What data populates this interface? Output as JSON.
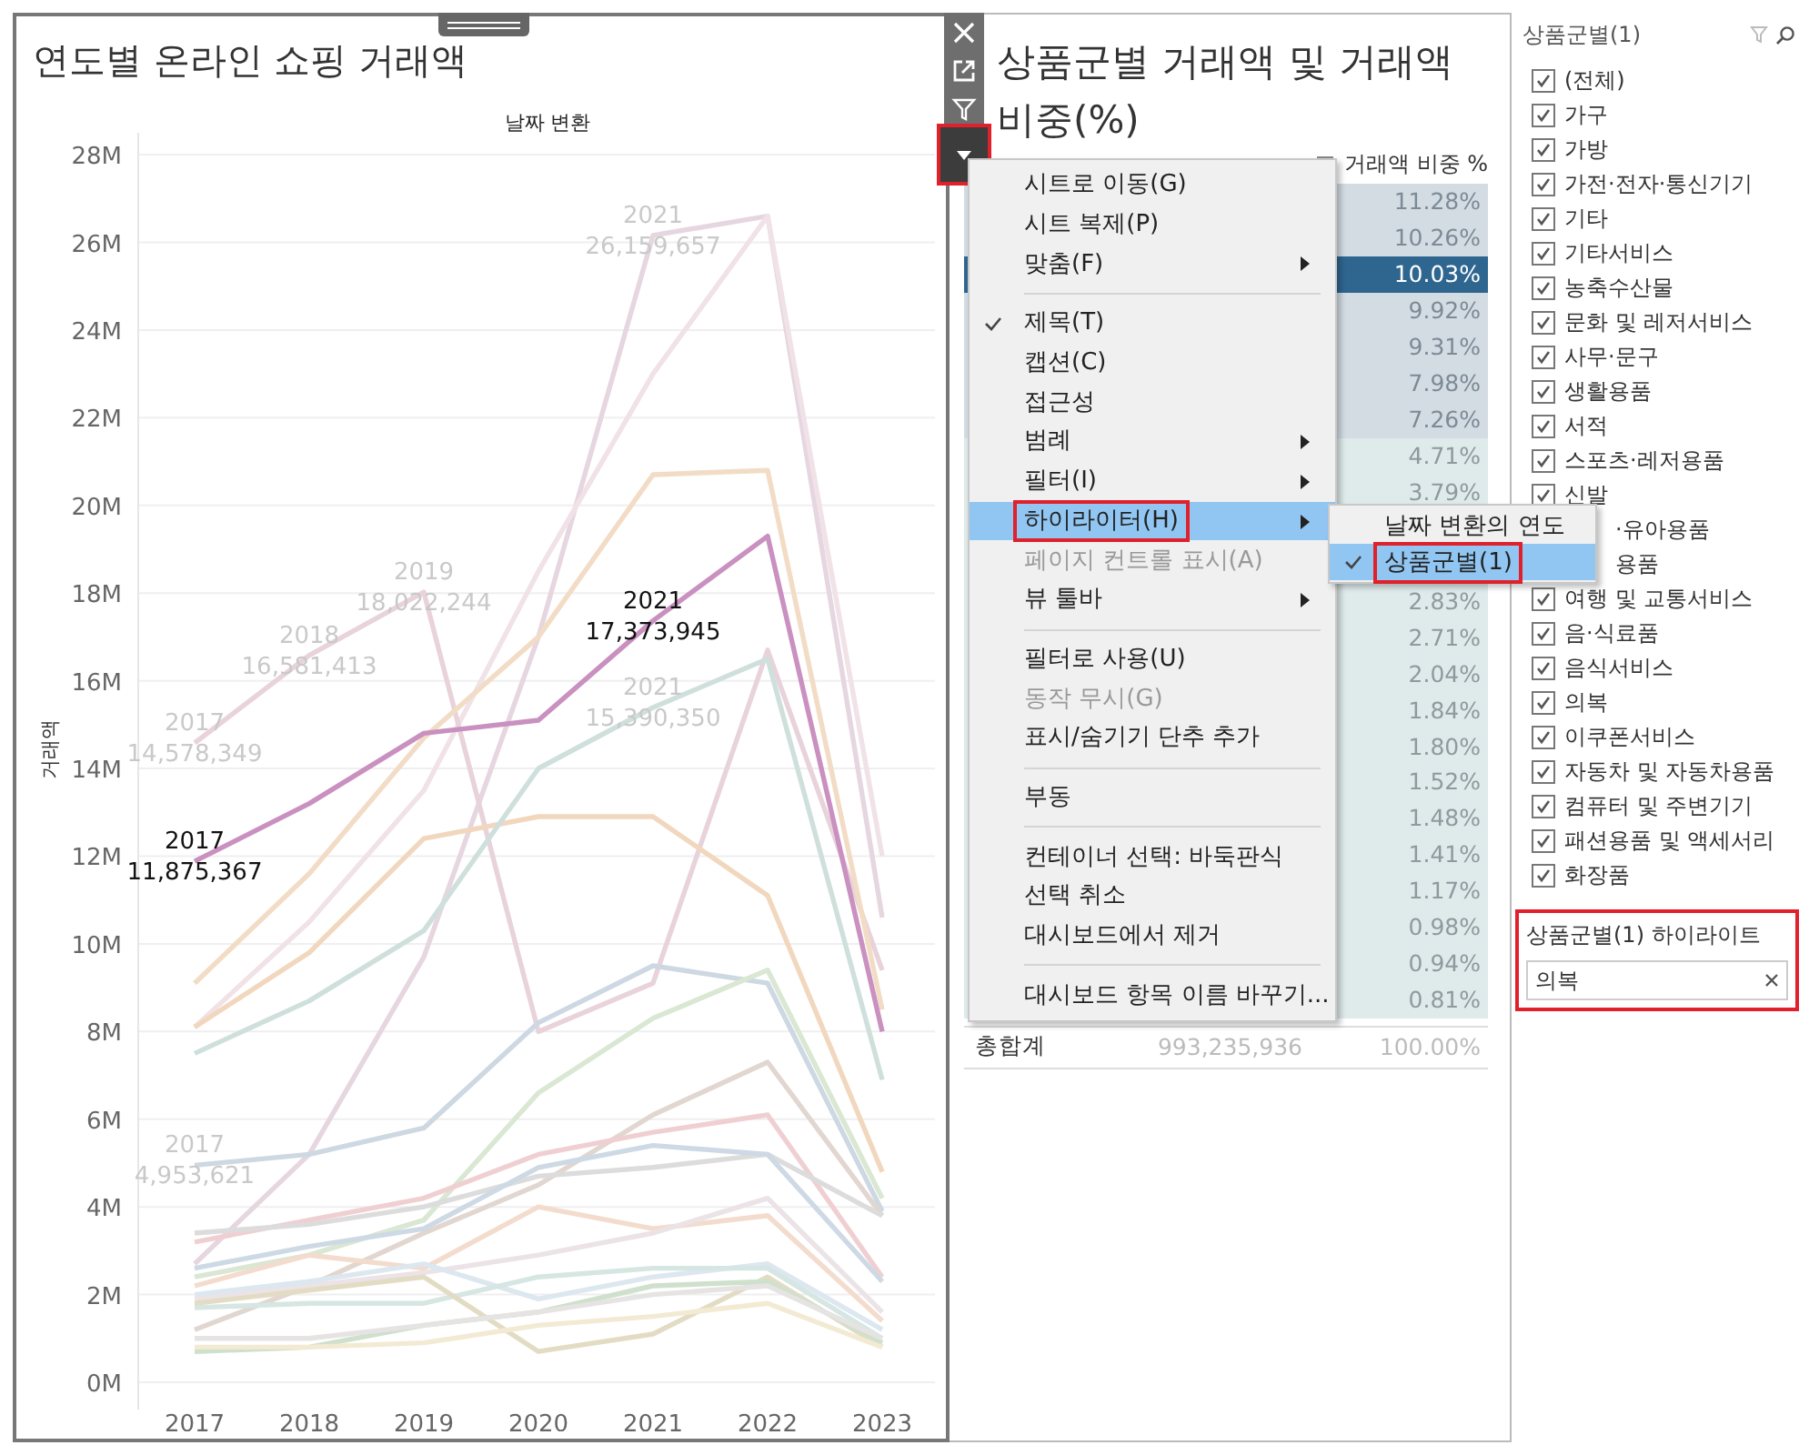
{
  "chart_panel": {
    "title": "연도별 온라인 쇼핑 거래액",
    "chart_data": {
      "type": "line",
      "title": "날짜 변환",
      "ylabel": "거래액",
      "grid": true,
      "x": [
        "2017",
        "2018",
        "2019",
        "2020",
        "2021",
        "2022",
        "2023"
      ],
      "ylim": [
        0,
        28.5
      ],
      "yticks": [
        {
          "value": 0,
          "label": "0M"
        },
        {
          "value": 2,
          "label": "2M"
        },
        {
          "value": 4,
          "label": "4M"
        },
        {
          "value": 6,
          "label": "6M"
        },
        {
          "value": 8,
          "label": "8M"
        },
        {
          "value": 10,
          "label": "10M"
        },
        {
          "value": 12,
          "label": "12M"
        },
        {
          "value": 14,
          "label": "14M"
        },
        {
          "value": 16,
          "label": "16M"
        },
        {
          "value": 18,
          "label": "18M"
        },
        {
          "value": 20,
          "label": "20M"
        },
        {
          "value": 22,
          "label": "22M"
        },
        {
          "value": 24,
          "label": "24M"
        },
        {
          "value": 26,
          "label": "26M"
        },
        {
          "value": 28,
          "label": "28M"
        }
      ],
      "series": [
        {
          "color": "#e6d6df",
          "values": [
            2.7,
            5.2,
            9.7,
            17.0,
            26.16,
            26.6,
            10.6
          ]
        },
        {
          "color": "#f0e2e7",
          "values": [
            8.1,
            10.5,
            13.5,
            18.5,
            23.0,
            26.6,
            12.0
          ]
        },
        {
          "color": "#e8d3da",
          "values": [
            14.58,
            16.58,
            18.02,
            8.0,
            9.1,
            16.7,
            9.4
          ]
        },
        {
          "color": "#f2dcc5",
          "values": [
            9.1,
            11.6,
            14.7,
            17.0,
            20.7,
            20.8,
            8.5
          ]
        },
        {
          "color": "#f1d7bd",
          "values": [
            8.1,
            9.8,
            12.4,
            12.9,
            12.9,
            11.1,
            4.8
          ]
        },
        {
          "color": "#cfe0dc",
          "values": [
            7.5,
            8.7,
            10.3,
            14.0,
            15.39,
            16.5,
            6.9
          ]
        },
        {
          "color": "#cdd8e2",
          "values": [
            4.95,
            5.2,
            5.8,
            8.2,
            9.5,
            9.1,
            3.9
          ]
        },
        {
          "color": "#d9e7d3",
          "values": [
            2.4,
            2.9,
            3.7,
            6.6,
            8.3,
            9.4,
            4.2
          ]
        },
        {
          "color": "#e1d6d0",
          "values": [
            1.2,
            2.2,
            3.4,
            4.5,
            6.1,
            7.3,
            3.8
          ]
        },
        {
          "color": "#f0cfd2",
          "values": [
            3.2,
            3.7,
            4.2,
            5.2,
            5.7,
            6.1,
            2.4
          ]
        },
        {
          "color": "#dcdcdc",
          "values": [
            3.4,
            3.6,
            4.0,
            4.7,
            4.9,
            5.2,
            3.8
          ]
        },
        {
          "color": "#cdd9e4",
          "values": [
            2.6,
            3.1,
            3.5,
            4.9,
            5.4,
            5.2,
            2.3
          ]
        },
        {
          "color": "#f3dccd",
          "values": [
            2.2,
            2.9,
            2.6,
            4.0,
            3.5,
            3.8,
            1.4
          ]
        },
        {
          "color": "#ebe3e6",
          "values": [
            1.9,
            2.2,
            2.5,
            2.9,
            3.4,
            4.2,
            1.6
          ]
        },
        {
          "color": "#dce7ef",
          "values": [
            2.0,
            2.3,
            2.7,
            1.9,
            2.4,
            2.7,
            1.2
          ]
        },
        {
          "color": "#d6e6e2",
          "values": [
            1.7,
            1.8,
            1.8,
            2.4,
            2.6,
            2.6,
            1.0
          ]
        },
        {
          "color": "#e3dcc4",
          "values": [
            1.8,
            2.1,
            2.4,
            0.7,
            1.1,
            2.4,
            0.8
          ]
        },
        {
          "color": "#cfe0cc",
          "values": [
            0.7,
            0.8,
            1.3,
            1.6,
            2.2,
            2.3,
            0.9
          ]
        },
        {
          "color": "#f2ead3",
          "values": [
            0.8,
            0.8,
            0.9,
            1.3,
            1.5,
            1.8,
            0.8
          ]
        },
        {
          "color": "#e6e3e3",
          "values": [
            1.0,
            1.0,
            1.3,
            1.6,
            2.0,
            2.2,
            1.0
          ]
        },
        {
          "color": "#c990c0",
          "values": [
            11.88,
            13.2,
            14.8,
            15.1,
            17.37,
            19.3,
            8.0
          ]
        }
      ],
      "annotations": [
        {
          "x": "2021",
          "y": 26.16,
          "text": "2021\n26,159,657"
        },
        {
          "x": "2019",
          "y": 18.02,
          "text": "2019\n18,022,244"
        },
        {
          "x": "2018",
          "y": 16.58,
          "text": "2018\n16,581,413"
        },
        {
          "x": "2017",
          "y": 14.58,
          "text": "2017\n14,578,349"
        },
        {
          "x": "2021",
          "y": 17.37,
          "text": "2021\n17,373,945"
        },
        {
          "x": "2021",
          "y": 15.39,
          "text": "2021\n15,390,350"
        },
        {
          "x": "2017",
          "y": 11.88,
          "text": "2017\n11,875,367"
        },
        {
          "x": "2017",
          "y": 4.95,
          "text": "2017\n4,953,621"
        }
      ]
    },
    "labels": [
      {
        "dimmed": true
      },
      {
        "dimmed": true
      },
      {
        "dimmed": true
      },
      {
        "dimmed": true
      },
      {
        "dimmed": false
      },
      {
        "dimmed": true
      },
      {
        "dimmed": false
      },
      {
        "dimmed": true
      }
    ]
  },
  "table_panel": {
    "title": "상품군별 거래액 및 거래액 비중(%)",
    "header": "거래액 비중 %",
    "rows": [
      {
        "share": "11.28%",
        "selected": false
      },
      {
        "share": "10.26%",
        "selected": false
      },
      {
        "share": "10.03%",
        "selected": true
      },
      {
        "share": "9.92%",
        "selected": false
      },
      {
        "share": "9.31%",
        "selected": false
      },
      {
        "share": "7.98%",
        "selected": false
      },
      {
        "share": "7.26%",
        "selected": false
      },
      {
        "share": "4.71%",
        "selected": false
      },
      {
        "share": "3.79%",
        "selected": false
      },
      {
        "selected": false
      },
      {
        "selected": false
      },
      {
        "share": "2.83%",
        "selected": false
      },
      {
        "share": "2.71%",
        "selected": false
      },
      {
        "share": "2.04%",
        "selected": false
      },
      {
        "share": "1.84%",
        "selected": false
      },
      {
        "share": "1.80%",
        "selected": false
      },
      {
        "share": "1.52%",
        "selected": false
      },
      {
        "share": "1.48%",
        "selected": false
      },
      {
        "share": "1.41%",
        "selected": false
      },
      {
        "share": "1.17%",
        "selected": false
      },
      {
        "share": "0.98%",
        "selected": false
      },
      {
        "share": "0.94%",
        "selected": false
      },
      {
        "share": "0.81%",
        "selected": false
      }
    ],
    "total": {
      "label": "총합계",
      "amount": "993,235,936",
      "share": "100.00%"
    }
  },
  "toolbar": {
    "menu_button": {
      "selected": true,
      "outlined": true
    }
  },
  "menu": {
    "items": [
      {
        "kind": "item",
        "label": "시트로 이동(G)",
        "checked": false,
        "submenu": false,
        "disabled": false,
        "selected": false,
        "outlined": false
      },
      {
        "kind": "item",
        "label": "시트 복제(P)",
        "checked": false,
        "submenu": false,
        "disabled": false,
        "selected": false,
        "outlined": false
      },
      {
        "kind": "item",
        "label": "맞춤(F)",
        "checked": false,
        "submenu": true,
        "disabled": false,
        "selected": false,
        "outlined": false
      },
      {
        "kind": "separator"
      },
      {
        "kind": "item",
        "label": "제목(T)",
        "checked": true,
        "submenu": false,
        "disabled": false,
        "selected": false,
        "outlined": false
      },
      {
        "kind": "item",
        "label": "캡션(C)",
        "checked": false,
        "submenu": false,
        "disabled": false,
        "selected": false,
        "outlined": false
      },
      {
        "kind": "item",
        "label": "접근성",
        "checked": false,
        "submenu": false,
        "disabled": false,
        "selected": false,
        "outlined": false
      },
      {
        "kind": "item",
        "label": "범례",
        "checked": false,
        "submenu": true,
        "disabled": false,
        "selected": false,
        "outlined": false
      },
      {
        "kind": "item",
        "label": "필터(I)",
        "checked": false,
        "submenu": true,
        "disabled": false,
        "selected": false,
        "outlined": false
      },
      {
        "kind": "item",
        "label": "하이라이터(H)",
        "checked": false,
        "submenu": true,
        "disabled": false,
        "selected": true,
        "outlined": true
      },
      {
        "kind": "item",
        "label": "페이지 컨트롤 표시(A)",
        "checked": false,
        "submenu": false,
        "disabled": true,
        "selected": false,
        "outlined": false
      },
      {
        "kind": "item",
        "label": "뷰 툴바",
        "checked": false,
        "submenu": true,
        "disabled": false,
        "selected": false,
        "outlined": false
      },
      {
        "kind": "separator"
      },
      {
        "kind": "item",
        "label": "필터로 사용(U)",
        "checked": false,
        "submenu": false,
        "disabled": false,
        "selected": false,
        "outlined": false
      },
      {
        "kind": "item",
        "label": "동작 무시(G)",
        "checked": false,
        "submenu": false,
        "disabled": true,
        "selected": false,
        "outlined": false
      },
      {
        "kind": "item",
        "label": "표시/숨기기 단추 추가",
        "checked": false,
        "submenu": false,
        "disabled": false,
        "selected": false,
        "outlined": false
      },
      {
        "kind": "separator"
      },
      {
        "kind": "item",
        "label": "부동",
        "checked": false,
        "submenu": false,
        "disabled": false,
        "selected": false,
        "outlined": false
      },
      {
        "kind": "separator"
      },
      {
        "kind": "item",
        "label": "컨테이너 선택: 바둑판식",
        "checked": false,
        "submenu": false,
        "disabled": false,
        "selected": false,
        "outlined": false
      },
      {
        "kind": "item",
        "label": "선택 취소",
        "checked": false,
        "submenu": false,
        "disabled": false,
        "selected": false,
        "outlined": false
      },
      {
        "kind": "item",
        "label": "대시보드에서 제거",
        "checked": false,
        "submenu": false,
        "disabled": false,
        "selected": false,
        "outlined": false
      },
      {
        "kind": "separator"
      },
      {
        "kind": "item",
        "label": "대시보드 항목 이름 바꾸기...",
        "checked": false,
        "submenu": false,
        "disabled": false,
        "selected": false,
        "outlined": false
      }
    ]
  },
  "submenu": {
    "items": [
      {
        "kind": "item",
        "label": "날짜 변환의 연도",
        "checked": false,
        "disabled": false,
        "selected": false,
        "outlined": false
      },
      {
        "kind": "item",
        "label": "상품군별(1)",
        "checked": true,
        "disabled": false,
        "selected": true,
        "outlined": true
      }
    ]
  },
  "filter": {
    "title": "상품군별(1)",
    "items": [
      {
        "label": "(전체)",
        "checked": true
      },
      {
        "label": "가구",
        "checked": true
      },
      {
        "label": "가방",
        "checked": true
      },
      {
        "label": "가전·전자·통신기기",
        "checked": true
      },
      {
        "label": "기타",
        "checked": true
      },
      {
        "label": "기타서비스",
        "checked": true
      },
      {
        "label": "농축수산물",
        "checked": true
      },
      {
        "label": "문화 및 레저서비스",
        "checked": true
      },
      {
        "label": "사무·문구",
        "checked": true
      },
      {
        "label": "생활용품",
        "checked": true
      },
      {
        "label": "서적",
        "checked": true
      },
      {
        "label": "스포츠·레저용품",
        "checked": true
      },
      {
        "label": "신발",
        "checked": true
      },
      {
        "label": "·유아용품",
        "covered": true
      },
      {
        "label": "용품",
        "covered": true
      },
      {
        "label": "여행 및 교통서비스",
        "checked": true
      },
      {
        "label": "음·식료품",
        "checked": true
      },
      {
        "label": "음식서비스",
        "checked": true
      },
      {
        "label": "의복",
        "checked": true
      },
      {
        "label": "이쿠폰서비스",
        "checked": true
      },
      {
        "label": "자동차 및 자동차용품",
        "checked": true
      },
      {
        "label": "컴퓨터 및 주변기기",
        "checked": true
      },
      {
        "label": "패션용품 및 액세서리",
        "checked": true
      },
      {
        "label": "화장품",
        "checked": true
      }
    ]
  },
  "highlighter": {
    "title": "상품군별(1) 하이라이트",
    "value": "의복",
    "outlined": true
  }
}
